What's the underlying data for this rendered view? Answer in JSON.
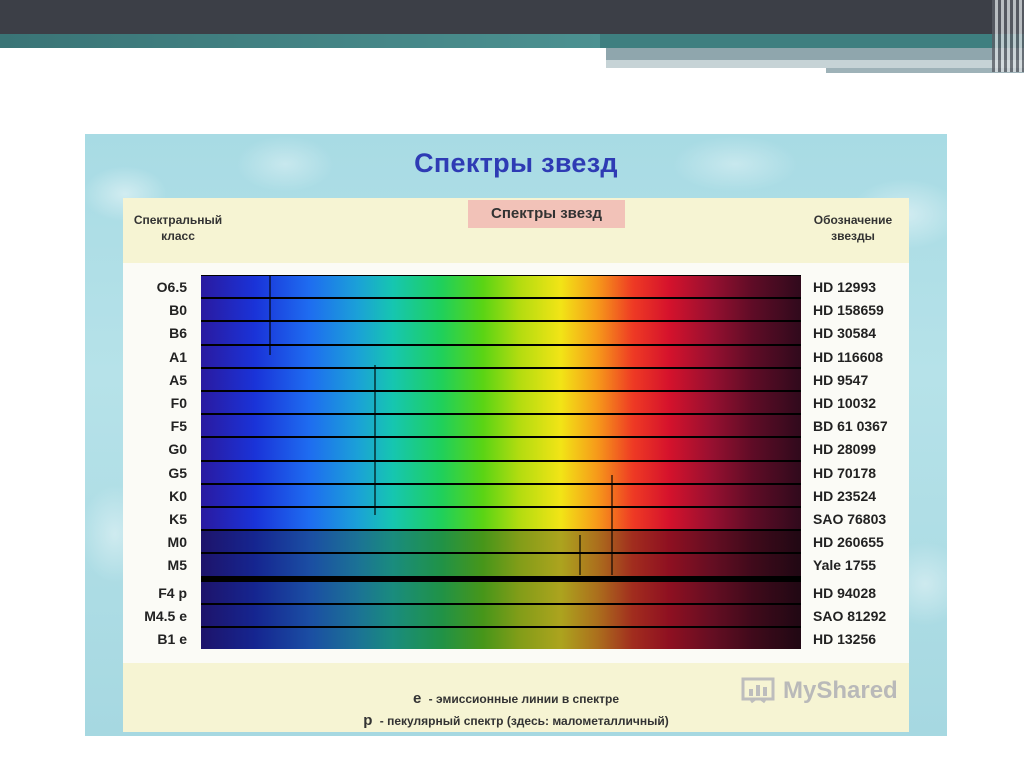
{
  "slide": {
    "title": "Спектры звезд"
  },
  "figure": {
    "header_label": "Спектры звезд",
    "left_column_header": "Спектральный класс",
    "right_column_header": "Обозначение звезды",
    "rows": [
      {
        "class": "O6.5",
        "star": "HD 12993"
      },
      {
        "class": "B0",
        "star": "HD 158659"
      },
      {
        "class": "B6",
        "star": "HD 30584"
      },
      {
        "class": "A1",
        "star": "HD 116608"
      },
      {
        "class": "A5",
        "star": "HD 9547"
      },
      {
        "class": "F0",
        "star": "HD 10032"
      },
      {
        "class": "F5",
        "star": "BD 61 0367"
      },
      {
        "class": "G0",
        "star": "HD 28099"
      },
      {
        "class": "G5",
        "star": "HD 70178"
      },
      {
        "class": "K0",
        "star": "HD 23524"
      },
      {
        "class": "K5",
        "star": "SAO 76803"
      },
      {
        "class": "M0",
        "star": "HD 260655"
      },
      {
        "class": "M5",
        "star": "Yale 1755"
      },
      {
        "class": "F4 p",
        "star": "HD 94028"
      },
      {
        "class": "M4.5 e",
        "star": "SAO 81292"
      },
      {
        "class": "B1 e",
        "star": "HD 13256"
      }
    ],
    "legend": {
      "e_key": "е",
      "e_text": "- эмиссионные линии в спектре",
      "p_key": "р",
      "p_text": "- пекулярный спектр (здесь: малометалличный)"
    },
    "watermark": "MyShared"
  }
}
